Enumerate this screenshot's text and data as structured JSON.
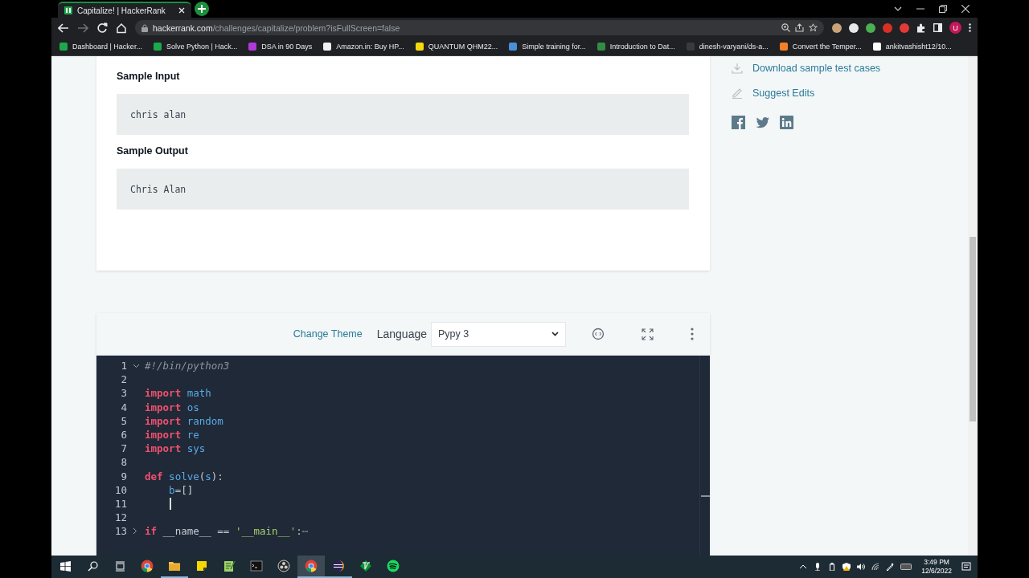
{
  "browser": {
    "tab": {
      "title": "Capitalize! | HackerRank",
      "selected": true
    },
    "nav": [
      {
        "kind": "back",
        "disabled": false
      },
      {
        "kind": "forward",
        "disabled": true
      },
      {
        "kind": "reload",
        "disabled": false
      },
      {
        "kind": "home",
        "disabled": false
      }
    ],
    "url": {
      "host": "hackerrank.com",
      "path": "/challenges/capitalize/problem?isFullScreen=false"
    },
    "extensions": [
      {
        "color": "#c9a27a"
      },
      {
        "color": "#e8e8e8"
      },
      {
        "color": "#4caf50"
      },
      {
        "color": "#d93025"
      },
      {
        "color": "#e53935"
      }
    ],
    "profile": "U",
    "bookmarks": [
      {
        "label": "Dashboard | Hacker...",
        "color": "#1ba94c"
      },
      {
        "label": "Solve Python | Hack...",
        "color": "#1ba94c"
      },
      {
        "label": "DSA in 90 Days",
        "color": "#b03ad9"
      },
      {
        "label": "Amazon.in: Buy HP...",
        "color": "#f0f0f0"
      },
      {
        "label": "QUANTUM QHM22...",
        "color": "#f5d90a"
      },
      {
        "label": "Simple training for...",
        "color": "#4a90d9"
      },
      {
        "label": "Introduction to Dat...",
        "color": "#2f8d46"
      },
      {
        "label": "dinesh-varyani/ds-a...",
        "color": "#3a3a3a"
      },
      {
        "label": "Convert the Temper...",
        "color": "#f48024"
      },
      {
        "label": "ankitvashisht12/10...",
        "color": "#ffffff"
      }
    ]
  },
  "problem": {
    "sections": [
      {
        "heading": "Sample Input",
        "sample": "chris alan"
      },
      {
        "heading": "Sample Output",
        "sample": "Chris Alan"
      }
    ]
  },
  "sidebar": {
    "links": [
      {
        "kind": "download",
        "label": "Download sample test cases"
      },
      {
        "kind": "edit",
        "label": "Suggest Edits"
      }
    ],
    "social": [
      {
        "kind": "facebook"
      },
      {
        "kind": "twitter"
      },
      {
        "kind": "linkedin"
      }
    ]
  },
  "editor": {
    "change_theme": "Change Theme",
    "language_label": "Language",
    "language": "Pypy 3",
    "lines": [
      {
        "number": "1",
        "expanded": true,
        "tokens": [
          {
            "text": "#!/bin/python3",
            "kind": "comment"
          }
        ]
      },
      {
        "number": "2"
      },
      {
        "number": "3",
        "tokens": [
          {
            "text": "import",
            "kind": "keyword"
          },
          {
            "text": " math",
            "kind": "name"
          }
        ]
      },
      {
        "number": "4",
        "tokens": [
          {
            "text": "import",
            "kind": "keyword"
          },
          {
            "text": " os",
            "kind": "name"
          }
        ]
      },
      {
        "number": "5",
        "tokens": [
          {
            "text": "import",
            "kind": "keyword"
          },
          {
            "text": " random",
            "kind": "name"
          }
        ]
      },
      {
        "number": "6",
        "tokens": [
          {
            "text": "import",
            "kind": "keyword"
          },
          {
            "text": " re",
            "kind": "name"
          }
        ]
      },
      {
        "number": "7",
        "tokens": [
          {
            "text": "import",
            "kind": "keyword"
          },
          {
            "text": " sys",
            "kind": "name"
          }
        ]
      },
      {
        "number": "8"
      },
      {
        "number": "9",
        "tokens": [
          {
            "text": "def",
            "kind": "keyword"
          },
          {
            "text": " solve",
            "kind": "name"
          },
          {
            "text": "(",
            "kind": "plain"
          },
          {
            "text": "s",
            "kind": "name"
          },
          {
            "text": "):",
            "kind": "plain"
          }
        ]
      },
      {
        "number": "10",
        "tokens": [
          {
            "text": "    b",
            "kind": "name"
          },
          {
            "text": "=[]",
            "kind": "plain"
          }
        ]
      },
      {
        "number": "11",
        "cursor": true
      },
      {
        "number": "12"
      },
      {
        "number": "13",
        "expanded": false,
        "tokens": [
          {
            "text": "if",
            "kind": "keyword"
          },
          {
            "text": " __name__ == ",
            "kind": "plain"
          },
          {
            "text": "'__main__'",
            "kind": "string"
          },
          {
            "text": ":",
            "kind": "plain"
          },
          {
            "text": "⋯",
            "kind": "comment"
          }
        ]
      }
    ]
  },
  "taskbar": {
    "apps": [
      {
        "kind": "chrome",
        "running": false,
        "active": false
      },
      {
        "kind": "folder",
        "running": true,
        "active": false
      },
      {
        "kind": "note",
        "running": false,
        "active": false
      },
      {
        "kind": "notepad",
        "running": false,
        "active": false
      },
      {
        "kind": "terminal",
        "running": false,
        "active": false
      },
      {
        "kind": "recorder",
        "running": false,
        "active": false
      },
      {
        "kind": "chrome",
        "running": true,
        "active": true
      },
      {
        "kind": "eclipse",
        "running": true,
        "active": false
      },
      {
        "kind": "vim",
        "running": false,
        "active": false
      },
      {
        "kind": "spotify",
        "running": false,
        "active": false
      }
    ],
    "time": "3:49 PM",
    "date": "12/6/2022"
  }
}
